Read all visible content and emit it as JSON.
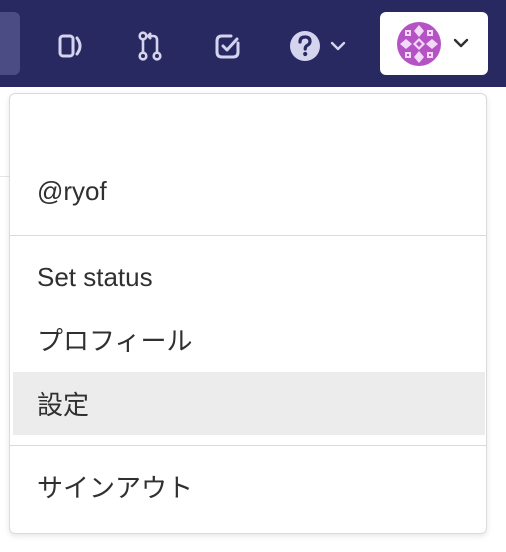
{
  "user_menu": {
    "username": "@ryof",
    "items": [
      "Set status",
      "プロフィール",
      "設定"
    ],
    "signout": "サインアウト"
  },
  "colors": {
    "topbar": "#292961",
    "avatar": "#b553c4",
    "highlight": "#ececec"
  }
}
